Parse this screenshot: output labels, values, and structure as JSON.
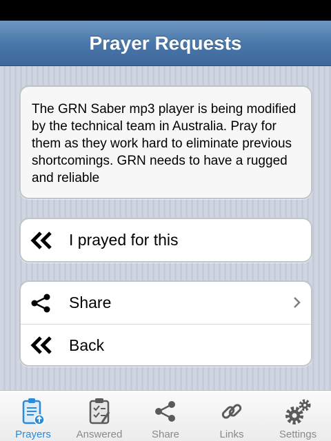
{
  "navbar": {
    "title": "Prayer Requests"
  },
  "request": {
    "text": "The GRN Saber mp3 player is being modified by the technical team in Australia. Pray for them as they work hard to eliminate previous shortcomings. GRN needs to have a rugged and reliable"
  },
  "prayed": {
    "label": "I prayed for this"
  },
  "actions": {
    "share_label": "Share",
    "back_label": "Back"
  },
  "tabs": [
    {
      "label": "Prayers",
      "icon": "prayers-clipboard-icon",
      "active": true
    },
    {
      "label": "Answered",
      "icon": "answered-checklist-icon",
      "active": false
    },
    {
      "label": "Share",
      "icon": "share-icon",
      "active": false
    },
    {
      "label": "Links",
      "icon": "link-icon",
      "active": false
    },
    {
      "label": "Settings",
      "icon": "gear-icon",
      "active": false
    }
  ],
  "colors": {
    "navbar": "#4a77aa",
    "active_tab": "#2c8ad8",
    "inactive_tab": "#8a8a8a"
  }
}
